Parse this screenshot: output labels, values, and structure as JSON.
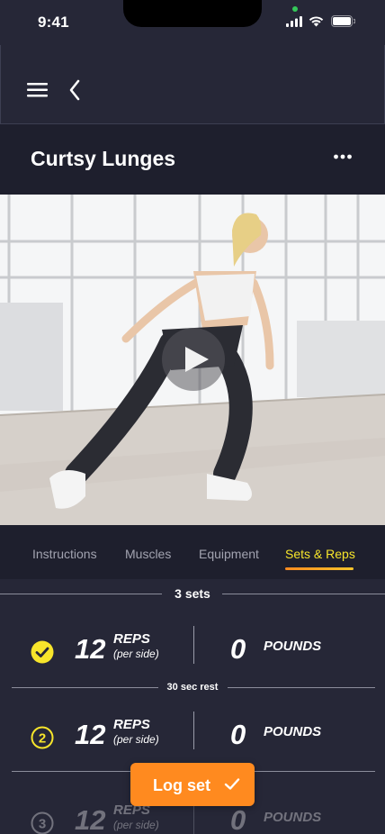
{
  "status_bar": {
    "time": "9:41"
  },
  "header": {
    "title": "Curtsy Lunges"
  },
  "tabs": [
    {
      "label": "Instructions",
      "active": false
    },
    {
      "label": "Muscles",
      "active": false
    },
    {
      "label": "Equipment",
      "active": false
    },
    {
      "label": "Sets & Reps",
      "active": true
    }
  ],
  "summary": {
    "sets_label": "3 sets"
  },
  "sets": [
    {
      "index": "1",
      "reps": "12",
      "reps_label": "REPS",
      "reps_sub": "(per side)",
      "weight": "0",
      "weight_unit": "POUNDS",
      "status": "completed"
    },
    {
      "index": "2",
      "reps": "12",
      "reps_label": "REPS",
      "reps_sub": "(per side)",
      "weight": "0",
      "weight_unit": "POUNDS",
      "status": "current"
    },
    {
      "index": "3",
      "reps": "12",
      "reps_label": "REPS",
      "reps_sub": "(per side)",
      "weight": "0",
      "weight_unit": "POUNDS",
      "status": "upcoming"
    }
  ],
  "rest": {
    "label": "30 sec rest"
  },
  "log_button": {
    "label": "Log set"
  },
  "colors": {
    "background": "#262737",
    "accent_orange": "#ff8a1f",
    "accent_yellow": "#f7e52b",
    "tab_inactive": "#a2a3b0"
  },
  "icons": {
    "menu": "hamburger-menu-icon",
    "back": "chevron-left-icon",
    "more": "more-horizontal-icon",
    "play": "play-icon",
    "completed": "check-circle-icon",
    "check": "check-icon"
  }
}
